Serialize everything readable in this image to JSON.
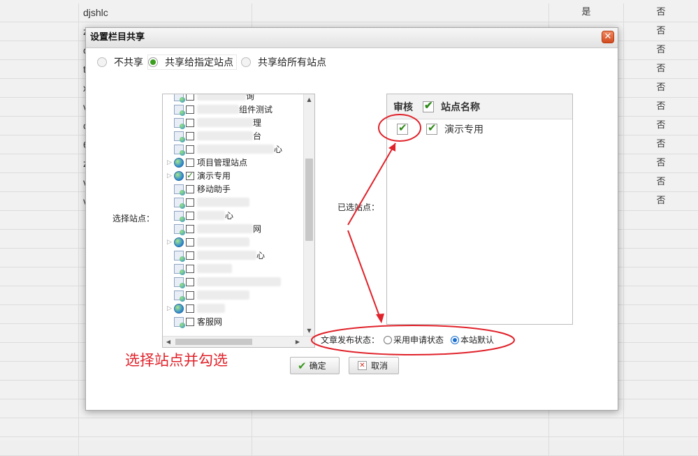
{
  "background_table": {
    "rows": [
      {
        "name": "djshlc",
        "col4": "是",
        "col5": "否"
      },
      {
        "name": "z",
        "col4": "",
        "col5": "否"
      },
      {
        "name": "c",
        "col4": "",
        "col5": "否"
      },
      {
        "name": "t",
        "col4": "",
        "col5": "否"
      },
      {
        "name": "x",
        "col4": "",
        "col5": "否"
      },
      {
        "name": "v",
        "col4": "",
        "col5": "否"
      },
      {
        "name": "c",
        "col4": "",
        "col5": "否"
      },
      {
        "name": "6",
        "col4": "",
        "col5": "否"
      },
      {
        "name": "z",
        "col4": "",
        "col5": "否"
      },
      {
        "name": "v",
        "col4": "",
        "col5": "否"
      },
      {
        "name": "v",
        "col4": "",
        "col5": "否"
      }
    ]
  },
  "dialog": {
    "title": "设置栏目共享",
    "close_symbol": "✕",
    "share_options": [
      {
        "label": "不共享",
        "selected": false
      },
      {
        "label": "共享给指定站点",
        "selected": true
      },
      {
        "label": "共享给所有站点",
        "selected": false
      }
    ],
    "select_site_label": "选择站点：",
    "selected_site_label": "已选站点：",
    "tree": [
      {
        "label": "询",
        "icon": "page-icon",
        "checked": false,
        "expandable": false,
        "blur_width": 70
      },
      {
        "label": "组件测试",
        "icon": "page-icon",
        "checked": false,
        "expandable": false,
        "blur_width": 60
      },
      {
        "label": "理",
        "icon": "page-icon",
        "checked": false,
        "expandable": false,
        "blur_width": 80
      },
      {
        "label": "台",
        "icon": "page-icon",
        "checked": false,
        "expandable": false,
        "blur_width": 80
      },
      {
        "label": "心",
        "icon": "page-icon",
        "checked": false,
        "expandable": false,
        "blur_width": 110
      },
      {
        "label": "项目管理站点",
        "icon": "globe-icon",
        "checked": false,
        "expandable": true,
        "blur_width": 0
      },
      {
        "label": "演示专用",
        "icon": "globe-icon",
        "checked": true,
        "expandable": true,
        "blur_width": 0
      },
      {
        "label": "移动助手",
        "icon": "page-icon",
        "checked": false,
        "expandable": false,
        "blur_width": 0
      },
      {
        "label": "",
        "icon": "page-icon",
        "checked": false,
        "expandable": false,
        "blur_width": 75
      },
      {
        "label": "心",
        "icon": "page-icon",
        "checked": false,
        "expandable": false,
        "blur_width": 40
      },
      {
        "label": "网",
        "icon": "page-icon",
        "checked": false,
        "expandable": false,
        "blur_width": 80
      },
      {
        "label": "",
        "icon": "globe-icon",
        "checked": false,
        "expandable": true,
        "blur_width": 75
      },
      {
        "label": "心",
        "icon": "page-icon",
        "checked": false,
        "expandable": false,
        "blur_width": 85
      },
      {
        "label": "",
        "icon": "page-icon",
        "checked": false,
        "expandable": false,
        "blur_width": 50
      },
      {
        "label": "",
        "icon": "page-icon",
        "checked": false,
        "expandable": false,
        "blur_width": 120
      },
      {
        "label": "",
        "icon": "page-icon",
        "checked": false,
        "expandable": false,
        "blur_width": 75
      },
      {
        "label": "",
        "icon": "globe-icon",
        "checked": false,
        "expandable": true,
        "blur_width": 40
      },
      {
        "label": "客服网",
        "icon": "page-icon",
        "checked": false,
        "expandable": false,
        "blur_width": 0
      }
    ],
    "selected_table": {
      "header_review": "审核",
      "header_site_name": "站点名称",
      "rows": [
        {
          "review_checked": true,
          "selected_checked": true,
          "name": "演示专用"
        }
      ]
    },
    "publish_status": {
      "label": "文章发布状态：",
      "options": [
        {
          "label": "采用申请状态",
          "selected": false
        },
        {
          "label": "本站默认",
          "selected": true
        }
      ]
    },
    "ok_label": "确定",
    "cancel_label": "取消"
  },
  "annotation": {
    "text": "选择站点并勾选",
    "color": "#e0222a"
  }
}
